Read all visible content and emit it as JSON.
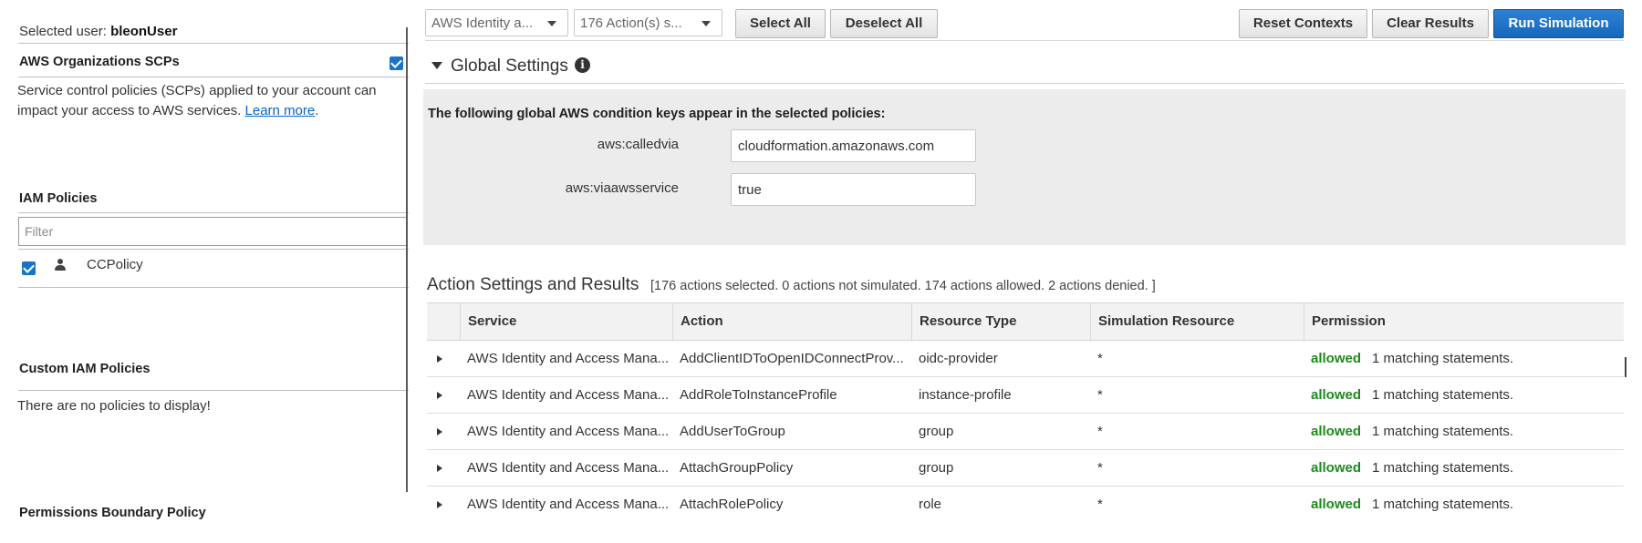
{
  "sidebar": {
    "selected_user_label": "Selected user:",
    "selected_user_name": "bleonUser",
    "scp_heading": "AWS Organizations SCPs",
    "scp_desc": "Service control policies (SCPs) applied to your account can impact your access to AWS services.",
    "scp_link": "Learn more",
    "iam_heading": "IAM Policies",
    "filter_placeholder": "Filter",
    "policy_name": "CCPolicy",
    "custom_heading": "Custom IAM Policies",
    "custom_empty": "There are no policies to display!",
    "boundary_heading": "Permissions Boundary Policy"
  },
  "toolbar": {
    "service_dropdown": "AWS Identity a...",
    "actions_dropdown": "176 Action(s) s...",
    "select_all": "Select All",
    "deselect_all": "Deselect All",
    "reset_contexts": "Reset Contexts",
    "clear_results": "Clear Results",
    "run_simulation": "Run Simulation"
  },
  "global_settings": {
    "title": "Global Settings",
    "description": "The following global AWS condition keys appear in the selected policies:",
    "keys": [
      {
        "label": "aws:calledvia",
        "value": "cloudformation.amazonaws.com"
      },
      {
        "label": "aws:viaawsservice",
        "value": "true"
      }
    ]
  },
  "action_settings": {
    "title": "Action Settings and Results",
    "summary": "[176 actions selected. 0 actions not simulated. 174 actions allowed. 2 actions denied. ]"
  },
  "table": {
    "headers": [
      "Service",
      "Action",
      "Resource Type",
      "Simulation Resource",
      "Permission"
    ],
    "rows": [
      {
        "service": "AWS Identity and Access Mana...",
        "action": "AddClientIDToOpenIDConnectProv...",
        "resource_type": "oidc-provider",
        "sim_resource": "*",
        "permission": "allowed",
        "statements": "1 matching statements."
      },
      {
        "service": "AWS Identity and Access Mana...",
        "action": "AddRoleToInstanceProfile",
        "resource_type": "instance-profile",
        "sim_resource": "*",
        "permission": "allowed",
        "statements": "1 matching statements."
      },
      {
        "service": "AWS Identity and Access Mana...",
        "action": "AddUserToGroup",
        "resource_type": "group",
        "sim_resource": "*",
        "permission": "allowed",
        "statements": "1 matching statements."
      },
      {
        "service": "AWS Identity and Access Mana...",
        "action": "AttachGroupPolicy",
        "resource_type": "group",
        "sim_resource": "*",
        "permission": "allowed",
        "statements": "1 matching statements."
      },
      {
        "service": "AWS Identity and Access Mana...",
        "action": "AttachRolePolicy",
        "resource_type": "role",
        "sim_resource": "*",
        "permission": "allowed",
        "statements": "1 matching statements."
      }
    ]
  },
  "colors": {
    "primary_button": "#1667b9",
    "allowed": "#1d8a1d",
    "checkbox": "#1a73c9",
    "panel_bg": "#ececec"
  }
}
